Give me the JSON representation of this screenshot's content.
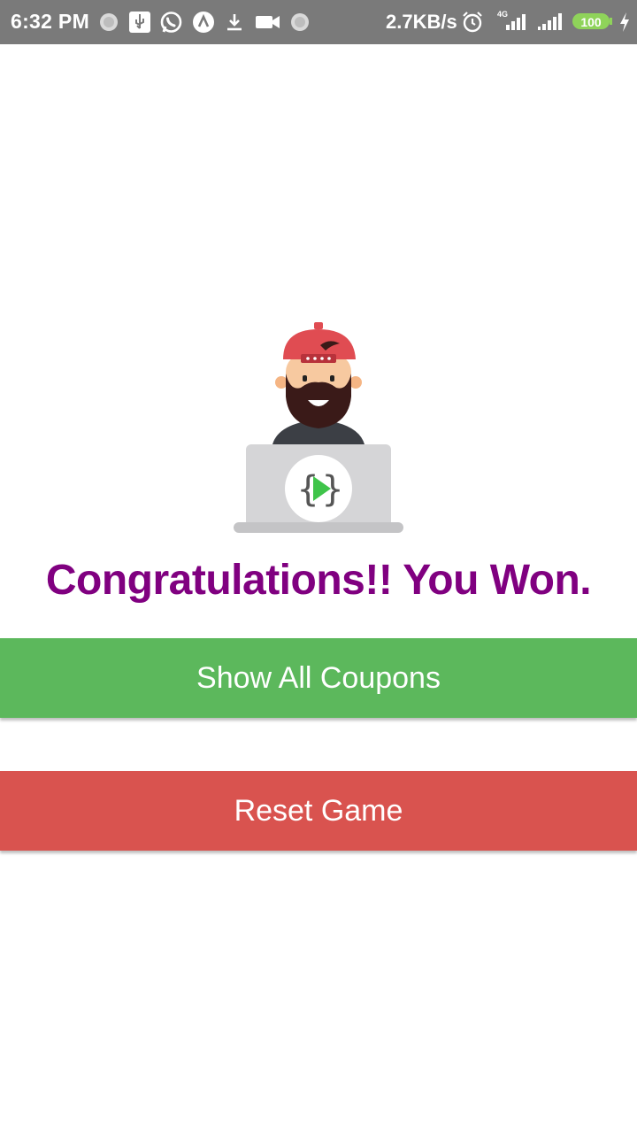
{
  "status_bar": {
    "time": "6:32 PM",
    "network_speed": "2.7KB/s",
    "network_type": "4G",
    "battery": "100",
    "icons": [
      "circle-icon",
      "usb-icon",
      "whatsapp-icon",
      "a-icon",
      "download-icon",
      "video-icon",
      "circle-icon",
      "alarm-icon",
      "signal-icon",
      "signal-icon",
      "battery-icon",
      "charging-icon"
    ]
  },
  "main": {
    "heading": "Congratulations!! You Won.",
    "show_coupons_label": "Show All Coupons",
    "reset_label": "Reset Game"
  },
  "colors": {
    "heading": "#800080",
    "show_coupons_button": "#5cb85c",
    "reset_button": "#d9534f",
    "status_bar": "#7a7a7a"
  }
}
